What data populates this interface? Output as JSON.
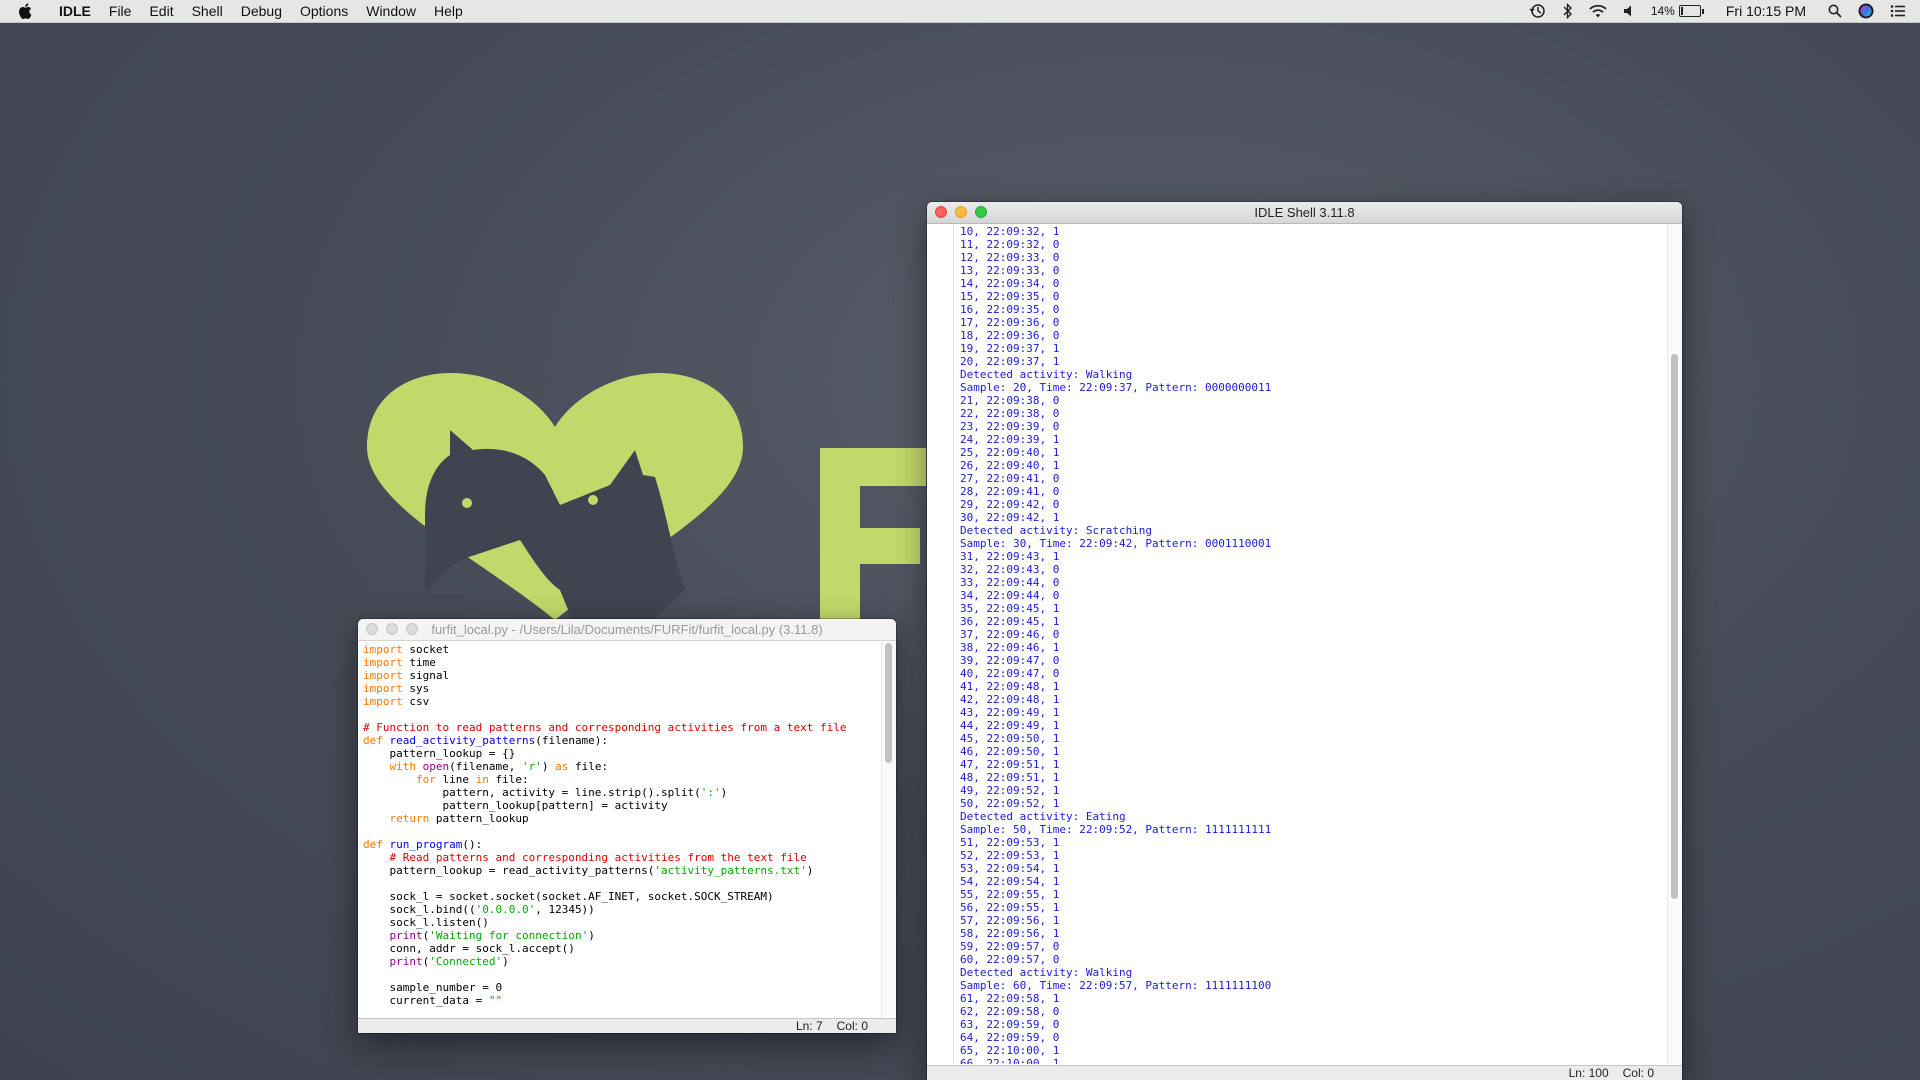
{
  "menubar": {
    "app_name": "IDLE",
    "menus": [
      "File",
      "Edit",
      "Shell",
      "Debug",
      "Options",
      "Window",
      "Help"
    ],
    "battery_percent": "14%",
    "battery_level": 0.14,
    "clock": "Fri 10:15 PM",
    "status_icons": [
      "time-machine-icon",
      "bluetooth-icon",
      "wifi-icon",
      "volume-icon",
      "battery-icon",
      "spotlight-search-icon",
      "siri-icon",
      "notification-center-icon"
    ]
  },
  "wallpaper": {
    "logo_colors": {
      "lime": "#c2d86a",
      "dark": "#3f4450"
    }
  },
  "editor": {
    "title": "furfit_local.py - /Users/Lila/Documents/FURFit/furfit_local.py (3.11.8)",
    "status_line": "Ln: 7",
    "status_col": "Col: 0",
    "code_lines": [
      "import socket",
      "import time",
      "import signal",
      "import sys",
      "import csv",
      "",
      "# Function to read patterns and corresponding activities from a text file",
      "def read_activity_patterns(filename):",
      "    pattern_lookup = {}",
      "    with open(filename, 'r') as file:",
      "        for line in file:",
      "            pattern, activity = line.strip().split(':')",
      "            pattern_lookup[pattern] = activity",
      "    return pattern_lookup",
      "",
      "def run_program():",
      "    # Read patterns and corresponding activities from the text file",
      "    pattern_lookup = read_activity_patterns('activity_patterns.txt')",
      "",
      "    sock_l = socket.socket(socket.AF_INET, socket.SOCK_STREAM)",
      "    sock_l.bind(('0.0.0.0', 12345))",
      "    sock_l.listen()",
      "    print('Waiting for connection')",
      "    conn, addr = sock_l.accept()",
      "    print('Connected')",
      "",
      "    sample_number = 0",
      "    current_data = \"\""
    ]
  },
  "shell": {
    "title": "IDLE Shell 3.11.8",
    "status_line": "Ln: 100",
    "status_col": "Col: 0",
    "output_lines": [
      "10, 22:09:32, 1",
      "11, 22:09:32, 0",
      "12, 22:09:33, 0",
      "13, 22:09:33, 0",
      "14, 22:09:34, 0",
      "15, 22:09:35, 0",
      "16, 22:09:35, 0",
      "17, 22:09:36, 0",
      "18, 22:09:36, 0",
      "19, 22:09:37, 1",
      "20, 22:09:37, 1",
      "Detected activity: Walking",
      "Sample: 20, Time: 22:09:37, Pattern: 0000000011",
      "21, 22:09:38, 0",
      "22, 22:09:38, 0",
      "23, 22:09:39, 0",
      "24, 22:09:39, 1",
      "25, 22:09:40, 1",
      "26, 22:09:40, 1",
      "27, 22:09:41, 0",
      "28, 22:09:41, 0",
      "29, 22:09:42, 0",
      "30, 22:09:42, 1",
      "Detected activity: Scratching",
      "Sample: 30, Time: 22:09:42, Pattern: 0001110001",
      "31, 22:09:43, 1",
      "32, 22:09:43, 0",
      "33, 22:09:44, 0",
      "34, 22:09:44, 0",
      "35, 22:09:45, 1",
      "36, 22:09:45, 1",
      "37, 22:09:46, 0",
      "38, 22:09:46, 1",
      "39, 22:09:47, 0",
      "40, 22:09:47, 0",
      "41, 22:09:48, 1",
      "42, 22:09:48, 1",
      "43, 22:09:49, 1",
      "44, 22:09:49, 1",
      "45, 22:09:50, 1",
      "46, 22:09:50, 1",
      "47, 22:09:51, 1",
      "48, 22:09:51, 1",
      "49, 22:09:52, 1",
      "50, 22:09:52, 1",
      "Detected activity: Eating",
      "Sample: 50, Time: 22:09:52, Pattern: 1111111111",
      "51, 22:09:53, 1",
      "52, 22:09:53, 1",
      "53, 22:09:54, 1",
      "54, 22:09:54, 1",
      "55, 22:09:55, 1",
      "56, 22:09:55, 1",
      "57, 22:09:56, 1",
      "58, 22:09:56, 1",
      "59, 22:09:57, 0",
      "60, 22:09:57, 0",
      "Detected activity: Walking",
      "Sample: 60, Time: 22:09:57, Pattern: 1111111100",
      "61, 22:09:58, 1",
      "62, 22:09:58, 0",
      "63, 22:09:59, 0",
      "64, 22:09:59, 0",
      "65, 22:10:00, 1",
      "66, 22:10:00, 1"
    ]
  }
}
